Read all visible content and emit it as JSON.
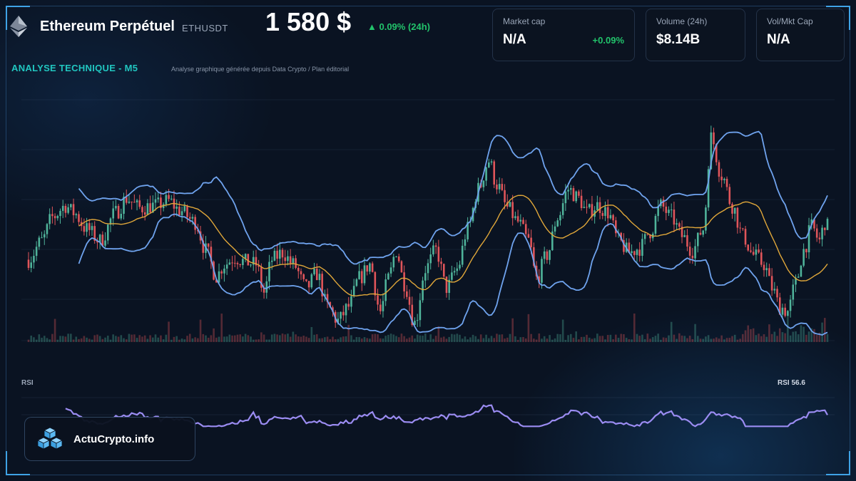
{
  "header": {
    "title": "Ethereum Perpétuel",
    "ticker": "ETHUSDT",
    "price": "1 580 $",
    "change": "▲ 0.09% (24h)"
  },
  "cards": [
    {
      "label": "Market cap",
      "value": "N/A",
      "change": "+0.09%"
    },
    {
      "label": "Volume (24h)",
      "value": "$8.14B",
      "change": ""
    },
    {
      "label": "Vol/Mkt Cap",
      "value": "N/A",
      "change": ""
    }
  ],
  "section": {
    "title": "ANALYSE TECHNIQUE - M5",
    "subtitle": "Analyse graphique générée depuis Data Crypto / Plan éditorial"
  },
  "brand": {
    "name": "ActuCrypto.info",
    "icon": "cubes-icon"
  },
  "colors": {
    "up": "#4fb39a",
    "down": "#e0555a",
    "bollinger": "#6fa3ee",
    "ma": "#e0a73a",
    "rsi": "#9b8cf2",
    "accent": "#21c6c0",
    "positive": "#22c36b"
  },
  "chart_data": [
    {
      "type": "candlestick",
      "interval": "M5",
      "indicators": [
        "bollinger-bands",
        "moving-average",
        "volume"
      ],
      "anchors": [
        [
          0,
          0.32
        ],
        [
          5,
          0.4
        ],
        [
          9,
          0.5
        ],
        [
          14,
          0.55
        ],
        [
          17,
          0.52
        ],
        [
          22,
          0.45
        ],
        [
          27,
          0.4
        ],
        [
          33,
          0.52
        ],
        [
          37,
          0.58
        ],
        [
          42,
          0.54
        ],
        [
          48,
          0.55
        ],
        [
          53,
          0.57
        ],
        [
          57,
          0.53
        ],
        [
          63,
          0.48
        ],
        [
          67,
          0.36
        ],
        [
          71,
          0.25
        ],
        [
          74,
          0.3
        ],
        [
          78,
          0.33
        ],
        [
          82,
          0.31
        ],
        [
          86,
          0.3
        ],
        [
          89,
          0.18
        ],
        [
          92,
          0.32
        ],
        [
          96,
          0.35
        ],
        [
          100,
          0.3
        ],
        [
          105,
          0.2
        ],
        [
          109,
          0.26
        ],
        [
          113,
          0.12
        ],
        [
          117,
          0.06
        ],
        [
          121,
          0.12
        ],
        [
          125,
          0.24
        ],
        [
          129,
          0.3
        ],
        [
          133,
          0.1
        ],
        [
          136,
          0.24
        ],
        [
          139,
          0.36
        ],
        [
          142,
          0.22
        ],
        [
          146,
          0.05
        ],
        [
          150,
          0.28
        ],
        [
          154,
          0.36
        ],
        [
          158,
          0.2
        ],
        [
          162,
          0.28
        ],
        [
          166,
          0.45
        ],
        [
          170,
          0.62
        ],
        [
          174,
          0.74
        ],
        [
          177,
          0.64
        ],
        [
          181,
          0.54
        ],
        [
          185,
          0.48
        ],
        [
          189,
          0.4
        ],
        [
          192,
          0.24
        ],
        [
          196,
          0.34
        ],
        [
          200,
          0.5
        ],
        [
          204,
          0.62
        ],
        [
          208,
          0.58
        ],
        [
          211,
          0.52
        ],
        [
          215,
          0.55
        ],
        [
          219,
          0.52
        ],
        [
          223,
          0.4
        ],
        [
          227,
          0.35
        ],
        [
          231,
          0.37
        ],
        [
          235,
          0.44
        ],
        [
          239,
          0.55
        ],
        [
          243,
          0.5
        ],
        [
          247,
          0.42
        ],
        [
          251,
          0.36
        ],
        [
          255,
          0.45
        ],
        [
          258,
          0.84
        ],
        [
          262,
          0.68
        ],
        [
          266,
          0.55
        ],
        [
          270,
          0.42
        ],
        [
          274,
          0.34
        ],
        [
          278,
          0.3
        ],
        [
          281,
          0.2
        ],
        [
          284,
          0.12
        ],
        [
          287,
          0.1
        ],
        [
          290,
          0.22
        ],
        [
          293,
          0.36
        ],
        [
          296,
          0.46
        ],
        [
          299,
          0.4
        ],
        [
          301,
          0.48
        ],
        [
          302,
          0.46
        ]
      ],
      "candles": 303,
      "rsi_last": "RSI 56.6"
    },
    {
      "type": "line",
      "name": "RSI",
      "label": "RSI",
      "last_label": "RSI 56.6",
      "last_value": 56.6
    }
  ]
}
